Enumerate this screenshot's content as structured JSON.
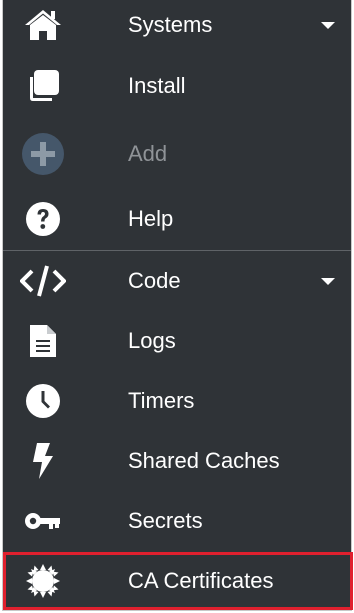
{
  "menu": {
    "systems": {
      "label": "Systems",
      "icon": "home-icon",
      "has_dropdown": true
    },
    "install": {
      "label": "Install",
      "icon": "copy-icon"
    },
    "add": {
      "label": "Add",
      "icon": "plus-circle-icon",
      "disabled": true
    },
    "help": {
      "label": "Help",
      "icon": "question-circle-icon"
    },
    "code": {
      "label": "Code",
      "icon": "code-icon",
      "has_dropdown": true
    },
    "logs": {
      "label": "Logs",
      "icon": "file-icon"
    },
    "timers": {
      "label": "Timers",
      "icon": "clock-icon"
    },
    "shared_caches": {
      "label": "Shared Caches",
      "icon": "lightning-icon"
    },
    "secrets": {
      "label": "Secrets",
      "icon": "key-icon"
    },
    "ca_certificates": {
      "label": "CA Certificates",
      "icon": "certificate-icon",
      "highlighted": true
    }
  },
  "colors": {
    "sidebar_bg": "#2f3337",
    "text": "#ffffff",
    "disabled_text": "#8f9397",
    "highlight_border": "#e0202e"
  }
}
